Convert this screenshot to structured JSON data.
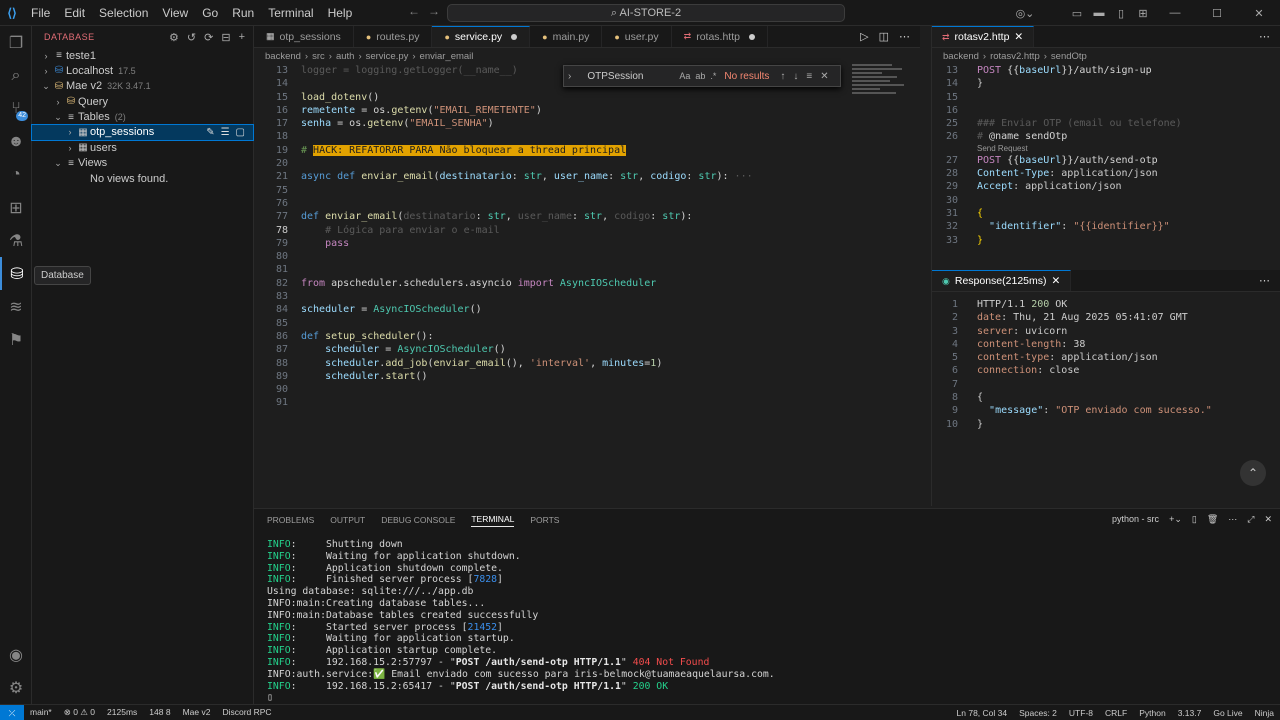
{
  "titlebar": {
    "menu": [
      "File",
      "Edit",
      "Selection",
      "View",
      "Go",
      "Run",
      "Terminal",
      "Help"
    ],
    "search": "AI-STORE-2"
  },
  "tooltip": "Database",
  "sidebar": {
    "title": "DATABASE",
    "items": [
      {
        "label": "teste1",
        "sub": "",
        "indent": 0,
        "chev": "›",
        "icon": "≡"
      },
      {
        "label": "Localhost",
        "sub": "17.5",
        "indent": 0,
        "chev": "›",
        "icon": "⛁"
      },
      {
        "label": "Mae v2",
        "sub": "32K 3.47.1",
        "indent": 0,
        "chev": "⌄",
        "icon": "⛁"
      },
      {
        "label": "Query",
        "sub": "",
        "indent": 1,
        "chev": "›",
        "icon": "⛁"
      },
      {
        "label": "Tables",
        "sub": "(2)",
        "indent": 1,
        "chev": "⌄",
        "icon": "≡"
      },
      {
        "label": "otp_sessions",
        "sub": "",
        "indent": 2,
        "chev": "›",
        "icon": "▦",
        "selected": true
      },
      {
        "label": "users",
        "sub": "",
        "indent": 2,
        "chev": "›",
        "icon": "▦"
      },
      {
        "label": "Views",
        "sub": "",
        "indent": 1,
        "chev": "⌄",
        "icon": "≡"
      },
      {
        "label": "No views found.",
        "sub": "",
        "indent": 2,
        "chev": "",
        "icon": ""
      }
    ]
  },
  "editor1": {
    "tabs": [
      {
        "label": "otp_sessions",
        "icon": "▦",
        "active": false,
        "dirty": false
      },
      {
        "label": "routes.py",
        "icon": "●",
        "active": false,
        "dirty": false
      },
      {
        "label": "service.py",
        "icon": "●",
        "active": true,
        "dirty": true
      },
      {
        "label": "main.py",
        "icon": "●",
        "active": false,
        "dirty": false
      },
      {
        "label": "user.py",
        "icon": "●",
        "active": false,
        "dirty": false
      },
      {
        "label": "rotas.http",
        "icon": "⇄",
        "active": false,
        "dirty": true
      }
    ],
    "breadcrumb": [
      "backend",
      "src",
      "auth",
      "service.py",
      "enviar_email"
    ],
    "find": {
      "query": "OTPSession",
      "result": "No results"
    },
    "lines": [
      {
        "n": "13",
        "html": "<span class='dim'>logger = logging.getLogger(__name__)</span>"
      },
      {
        "n": "14",
        "html": ""
      },
      {
        "n": "15",
        "html": "<span class='fn'>load_dotenv</span>()"
      },
      {
        "n": "16",
        "html": "<span class='par'>remetente</span> = os.<span class='fn'>getenv</span>(<span class='str'>\"EMAIL_REMETENTE\"</span>)"
      },
      {
        "n": "17",
        "html": "<span class='par'>senha</span> = os.<span class='fn'>getenv</span>(<span class='str'>\"EMAIL_SENHA\"</span>)"
      },
      {
        "n": "18",
        "html": ""
      },
      {
        "n": "19",
        "html": "<span class='cmt'># </span><span class='hack'>HACK: REFATORAR PARA Não bloquear a thread principal</span>"
      },
      {
        "n": "20",
        "html": ""
      },
      {
        "n": "21",
        "html": "<span class='kw'>async def</span> <span class='fn'>enviar_email</span>(<span class='par'>destinatario</span>: <span class='cls'>str</span>, <span class='par'>user_name</span>: <span class='cls'>str</span>, <span class='par'>codigo</span>: <span class='cls'>str</span>):<span class='dim'> ···</span>"
      },
      {
        "n": "75",
        "html": ""
      },
      {
        "n": "76",
        "html": ""
      },
      {
        "n": "77",
        "html": "<span class='kw'>def</span> <span class='fn'>enviar_email</span>(<span class='dim'>destinatario</span>: <span class='cls'>str</span>, <span class='dim'>user_name</span>: <span class='cls'>str</span>, <span class='dim'>codigo</span>: <span class='cls'>str</span>):"
      },
      {
        "n": "78",
        "html": "    <span class='dim'># Lógica para enviar o e-mail</span>",
        "cur": true
      },
      {
        "n": "79",
        "html": "    <span class='kw2'>pass</span>"
      },
      {
        "n": "80",
        "html": ""
      },
      {
        "n": "81",
        "html": ""
      },
      {
        "n": "82",
        "html": "<span class='kw2'>from</span> apscheduler.schedulers.asyncio <span class='kw2'>import</span> <span class='cls'>AsyncIOScheduler</span>"
      },
      {
        "n": "83",
        "html": ""
      },
      {
        "n": "84",
        "html": "<span class='par'>scheduler</span> = <span class='cls'>AsyncIOScheduler</span>()"
      },
      {
        "n": "85",
        "html": ""
      },
      {
        "n": "86",
        "html": "<span class='kw'>def</span> <span class='fn'>setup_scheduler</span>():"
      },
      {
        "n": "87",
        "html": "    <span class='par'>scheduler</span> = <span class='cls'>AsyncIOScheduler</span>()"
      },
      {
        "n": "88",
        "html": "    <span class='par'>scheduler</span>.<span class='fn'>add_job</span>(<span class='fn'>enviar_email</span>(), <span class='str'>'interval'</span>, <span class='par'>minutes</span>=<span class='num'>1</span>)"
      },
      {
        "n": "89",
        "html": "    <span class='par'>scheduler</span>.<span class='fn'>start</span>()"
      },
      {
        "n": "90",
        "html": ""
      },
      {
        "n": "91",
        "html": ""
      }
    ]
  },
  "editor2": {
    "tab": "rotasv2.http",
    "breadcrumb": [
      "backend",
      "rotasv2.http",
      "sendOtp"
    ],
    "lines": [
      {
        "n": "13",
        "html": "<span class='http-k'>POST</span> <span class='http-v'>{{</span><span class='var'>baseUrl</span><span class='http-v'>}}/auth/sign-up</span>"
      },
      {
        "n": "14",
        "html": "}"
      },
      {
        "n": "15",
        "html": ""
      },
      {
        "n": "16",
        "html": ""
      },
      {
        "n": "25",
        "html": "<span class='dim'>### Enviar OTP (email ou telefone)</span>"
      },
      {
        "n": "26",
        "html": "<span class='dim'># </span><span class='http-v'>@name sendOtp</span>"
      },
      {
        "n": "",
        "lens": "Send Request"
      },
      {
        "n": "27",
        "html": "<span class='http-k'>POST</span> <span class='http-v'>{{</span><span class='var'>baseUrl</span><span class='http-v'>}}/auth/send-otp</span>"
      },
      {
        "n": "28",
        "html": "<span class='hdr'>Content-Type</span>: application/json"
      },
      {
        "n": "29",
        "html": "<span class='hdr'>Accept</span>: application/json"
      },
      {
        "n": "30",
        "html": ""
      },
      {
        "n": "31",
        "html": "<span style='color:#ffd700'>{</span>"
      },
      {
        "n": "32",
        "html": "  <span class='hdr'>\"identifier\"</span>: <span class='str'>\"{{identifier}}\"</span>"
      },
      {
        "n": "33",
        "html": "<span style='color:#ffd700'>}</span>"
      }
    ]
  },
  "response": {
    "tab": "Response(2125ms)",
    "lines": [
      {
        "n": "1",
        "html": "HTTP/1.1 <span class='num'>200</span> OK"
      },
      {
        "n": "2",
        "html": "<span class='str'>date</span>: Thu, 21 Aug 2025 05:41:07 GMT"
      },
      {
        "n": "3",
        "html": "<span class='str'>server</span>: uvicorn"
      },
      {
        "n": "4",
        "html": "<span class='str'>content-length</span>: 38"
      },
      {
        "n": "5",
        "html": "<span class='str'>content-type</span>: application/json"
      },
      {
        "n": "6",
        "html": "<span class='str'>connection</span>: close"
      },
      {
        "n": "7",
        "html": ""
      },
      {
        "n": "8",
        "html": "{"
      },
      {
        "n": "9",
        "html": "  <span class='hdr'>\"message\"</span>: <span class='str'>\"OTP enviado com sucesso.\"</span>"
      },
      {
        "n": "10",
        "html": "}"
      }
    ]
  },
  "panel": {
    "tabs": [
      "PROBLEMS",
      "OUTPUT",
      "DEBUG CONSOLE",
      "TERMINAL",
      "PORTS"
    ],
    "active_tab": "TERMINAL",
    "shell": "python - src",
    "terminal": [
      "<span class='g'>INFO</span>:     Shutting down",
      "<span class='g'>INFO</span>:     Waiting for application shutdown.",
      "<span class='g'>INFO</span>:     Application shutdown complete.",
      "<span class='g'>INFO</span>:     Finished server process [<span class='bl'>7828</span>]",
      "Using database: sqlite:///../app.db",
      "INFO:main:Creating database tables...",
      "INFO:main:Database tables created successfully",
      "<span class='g'>INFO</span>:     Started server process [<span class='bl'>21452</span>]",
      "<span class='g'>INFO</span>:     Waiting for application startup.",
      "<span class='g'>INFO</span>:     Application startup complete.",
      "<span class='g'>INFO</span>:     192.168.15.2:57797 - \"<span class='wh'><b>POST /auth/send-otp HTTP/1.1</b></span>\" <span class='rd'>404 Not Found</span>",
      "INFO:auth.service:<span class='g'>✅</span> Email enviado com sucesso para iris-belmock@tuamaeaquelaursa.com.",
      "<span class='g'>INFO</span>:     192.168.15.2:65417 - \"<span class='wh'><b>POST /auth/send-otp HTTP/1.1</b></span>\" <span class='g'>200 OK</span>",
      "▯"
    ]
  },
  "status": {
    "left": [
      "main*",
      "⊗ 0 ⚠ 0",
      "2125ms",
      "148 8",
      "Mae v2",
      "Discord RPC"
    ],
    "right": [
      "Ln 78, Col 34",
      "Spaces: 2",
      "UTF-8",
      "CRLF",
      "Python",
      "3.13.7",
      "Go Live",
      "Ninja"
    ]
  }
}
